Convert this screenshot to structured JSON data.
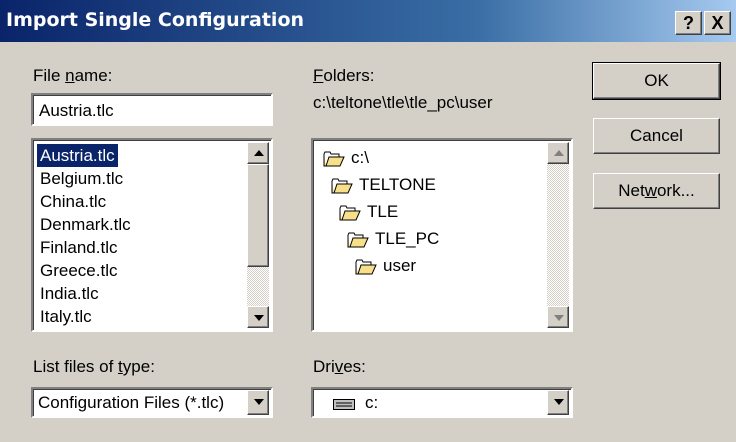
{
  "window": {
    "title": "Import Single Configuration",
    "help_label": "?",
    "close_label": "X"
  },
  "file_name": {
    "label_pre": "File ",
    "label_acc": "n",
    "label_post": "ame:",
    "value": "Austria.tlc",
    "files": [
      "Austria.tlc",
      "Belgium.tlc",
      "China.tlc",
      "Denmark.tlc",
      "Finland.tlc",
      "Greece.tlc",
      "India.tlc",
      "Italy.tlc"
    ],
    "selected": "Austria.tlc"
  },
  "folders": {
    "label_acc": "F",
    "label_post": "olders:",
    "path": "c:\\teltone\\tle\\tle_pc\\user",
    "tree": [
      {
        "name": "c:\\",
        "icon": "open-folder-icon"
      },
      {
        "name": "TELTONE",
        "icon": "open-folder-icon"
      },
      {
        "name": "TLE",
        "icon": "open-folder-icon"
      },
      {
        "name": "TLE_PC",
        "icon": "open-folder-icon"
      },
      {
        "name": "user",
        "icon": "open-folder-icon"
      }
    ]
  },
  "file_type": {
    "label_pre": "List files of ",
    "label_acc": "t",
    "label_post": "ype:",
    "value": "Configuration Files (*.tlc)"
  },
  "drives": {
    "label_pre": "Dri",
    "label_acc": "v",
    "label_post": "es:",
    "value": "c:",
    "icon": "drive-icon"
  },
  "buttons": {
    "ok": "OK",
    "cancel": "Cancel",
    "network_pre": "Net",
    "network_acc": "w",
    "network_post": "ork..."
  },
  "colors": {
    "title_bar": "#0a246a",
    "selection": "#0a246a",
    "face": "#d4d0c8",
    "folder": "#f8e08a"
  }
}
